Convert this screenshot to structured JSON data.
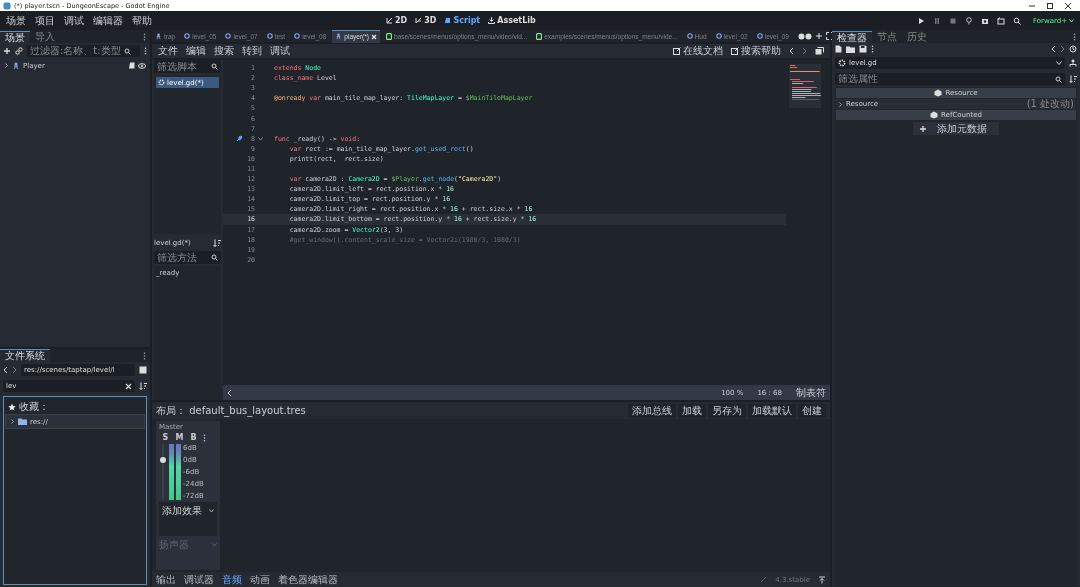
{
  "window": {
    "title": "(*) player.tscn - DungeonEscape - Godot Engine"
  },
  "menu": [
    "场景",
    "项目",
    "调试",
    "编辑器",
    "帮助"
  ],
  "workspaces": [
    {
      "label": "2D",
      "kind": "planar",
      "selected": false
    },
    {
      "label": "3D",
      "kind": "spatial",
      "selected": false
    },
    {
      "label": "Script",
      "kind": "script",
      "selected": true
    },
    {
      "label": "AssetLib",
      "kind": "assetlib",
      "selected": false
    }
  ],
  "renderer": "Forward+",
  "scene_dock": {
    "tabs": [
      {
        "label": "场景",
        "selected": true
      },
      {
        "label": "导入",
        "selected": false
      }
    ],
    "filter": {
      "placeholder": "过滤器:名称、t:类型"
    },
    "tree": [
      {
        "label": "Player",
        "expanded": false
      }
    ]
  },
  "filesystem": {
    "tab": "文件系统",
    "path": "res://scenes/taptap/level/l",
    "search": "lev",
    "favorites": "收藏：",
    "tree": [
      {
        "label": "res://",
        "expanded": false
      }
    ]
  },
  "editor_tabs": [
    {
      "label": "trap",
      "kind": "node",
      "selected": false
    },
    {
      "label": "level_05",
      "kind": "scene",
      "selected": false
    },
    {
      "label": "level_07",
      "kind": "scene",
      "selected": false
    },
    {
      "label": "test",
      "kind": "scene",
      "selected": false
    },
    {
      "label": "level_08",
      "kind": "scene",
      "selected": false
    },
    {
      "label": "player(*)",
      "kind": "node",
      "selected": true
    },
    {
      "label": "base/scenes/menus/options_menu/video/vid...",
      "kind": "script",
      "selected": false
    },
    {
      "label": "examples/scenes/menus/options_menu/vide...",
      "kind": "script",
      "selected": false
    },
    {
      "label": "Hud",
      "kind": "scene",
      "selected": false
    },
    {
      "label": "level_02",
      "kind": "scene",
      "selected": false
    },
    {
      "label": "level_09",
      "kind": "scene",
      "selected": false
    }
  ],
  "script_menu": [
    "文件",
    "编辑",
    "搜索",
    "转到",
    "调试"
  ],
  "help_links": [
    "在线文档",
    "搜索帮助"
  ],
  "script_list": {
    "filter": {
      "placeholder": "筛选脚本"
    },
    "items": [
      {
        "label": "level.gd(*)",
        "selected": true
      }
    ],
    "current": "level.gd(*)",
    "method_filter": {
      "placeholder": "筛选方法"
    },
    "methods": [
      "_ready"
    ]
  },
  "code": {
    "lines": [
      {
        "number": "1",
        "current": false,
        "signal": false,
        "foldable": false,
        "tokens": [
          {
            "t": "extends",
            "kind": "keyword"
          },
          {
            "t": " Node",
            "kind": "type"
          }
        ]
      },
      {
        "number": "2",
        "current": false,
        "signal": false,
        "foldable": false,
        "tokens": [
          {
            "t": "class_name",
            "kind": "keyword"
          },
          {
            "t": " Level",
            "kind": "plain"
          }
        ]
      },
      {
        "number": "3",
        "current": false,
        "signal": false,
        "foldable": false
      },
      {
        "number": "4",
        "current": false,
        "signal": false,
        "foldable": false,
        "tokens": [
          {
            "t": "@onready",
            "kind": "annotation"
          },
          {
            "t": " var",
            "kind": "keyword"
          },
          {
            "t": " main_tile_map_layer: ",
            "kind": "plain"
          },
          {
            "t": "TileMapLayer",
            "kind": "type"
          },
          {
            "t": " = ",
            "kind": "plain"
          },
          {
            "t": "$MainTileMapLayer",
            "kind": "node"
          }
        ]
      },
      {
        "number": "5",
        "current": false,
        "signal": false,
        "foldable": false
      },
      {
        "number": "6",
        "current": false,
        "signal": false,
        "foldable": false
      },
      {
        "number": "7",
        "current": false,
        "signal": false,
        "foldable": false
      },
      {
        "number": "8",
        "current": false,
        "signal": true,
        "foldable": true,
        "tokens": [
          {
            "t": "func",
            "kind": "keyword"
          },
          {
            "t": " _ready() -> ",
            "kind": "plain"
          },
          {
            "t": "void",
            "kind": "keyword"
          },
          {
            "t": ":",
            "kind": "plain"
          }
        ]
      },
      {
        "number": "9",
        "current": false,
        "signal": false,
        "foldable": false,
        "tokens": [
          {
            "t": "\tvar",
            "kind": "keyword"
          },
          {
            "t": " rect := main_tile_map_layer.",
            "kind": "plain"
          },
          {
            "t": "get_used_rect",
            "kind": "function"
          },
          {
            "t": "()",
            "kind": "plain"
          }
        ]
      },
      {
        "number": "10",
        "current": false,
        "signal": false,
        "foldable": false,
        "tokens": [
          {
            "t": "\tprintt(rect,  rect.size)",
            "kind": "plain"
          }
        ]
      },
      {
        "number": "11",
        "current": false,
        "signal": false,
        "foldable": false
      },
      {
        "number": "12",
        "current": false,
        "signal": false,
        "foldable": false,
        "tokens": [
          {
            "t": "\tvar",
            "kind": "keyword"
          },
          {
            "t": " camera2D : ",
            "kind": "plain"
          },
          {
            "t": "Camera2D",
            "kind": "type"
          },
          {
            "t": " = ",
            "kind": "plain"
          },
          {
            "t": "$Player",
            "kind": "node"
          },
          {
            "t": ".",
            "kind": "plain"
          },
          {
            "t": "get_node",
            "kind": "function"
          },
          {
            "t": "(",
            "kind": "plain"
          },
          {
            "t": "\"Camera2D\"",
            "kind": "string"
          },
          {
            "t": ")",
            "kind": "plain"
          }
        ]
      },
      {
        "number": "13",
        "current": false,
        "signal": false,
        "foldable": false,
        "tokens": [
          {
            "t": "\tcamera2D.limit_left = rect.position.x * ",
            "kind": "plain"
          },
          {
            "t": "16",
            "kind": "number"
          }
        ]
      },
      {
        "number": "14",
        "current": false,
        "signal": false,
        "foldable": false,
        "tokens": [
          {
            "t": "\tcamera2D.limit_top = rect.position.y * ",
            "kind": "plain"
          },
          {
            "t": "16",
            "kind": "number"
          }
        ]
      },
      {
        "number": "15",
        "current": false,
        "signal": false,
        "foldable": false,
        "tokens": [
          {
            "t": "\tcamera2D.limit_right = rect.position.x * ",
            "kind": "plain"
          },
          {
            "t": "16",
            "kind": "number"
          },
          {
            "t": " + rect.size.x * ",
            "kind": "plain"
          },
          {
            "t": "16",
            "kind": "number"
          }
        ]
      },
      {
        "number": "16",
        "current": true,
        "signal": false,
        "foldable": false,
        "tokens": [
          {
            "t": "\tcamera2D.limit_bottom = rect.position.y * ",
            "kind": "plain"
          },
          {
            "t": "16",
            "kind": "number"
          },
          {
            "t": " + rect.size.y * ",
            "kind": "plain"
          },
          {
            "t": "16",
            "kind": "number"
          }
        ]
      },
      {
        "number": "17",
        "current": false,
        "signal": false,
        "foldable": false,
        "tokens": [
          {
            "t": "\tcamera2D.zoom = ",
            "kind": "plain"
          },
          {
            "t": "Vector2",
            "kind": "type"
          },
          {
            "t": "(3, 3)",
            "kind": "plain"
          }
        ]
      },
      {
        "number": "18",
        "current": false,
        "signal": false,
        "foldable": false,
        "tokens": [
          {
            "t": "\t#get_window().content_scale_size = Vector2i(1980/3, 1080/3)",
            "kind": "comment"
          }
        ]
      },
      {
        "number": "19",
        "current": false,
        "signal": false,
        "foldable": false
      },
      {
        "number": "20",
        "current": false,
        "signal": false,
        "foldable": false
      }
    ]
  },
  "status_bar": {
    "zoom": "100 %",
    "position": "16 :  68",
    "indent": "制表符"
  },
  "audio": {
    "layout": "布局： default_bus_layout.tres",
    "buttons": [
      "添加总线",
      "加载",
      "另存为",
      "加载默认",
      "创建"
    ],
    "bus": {
      "name": "Master",
      "toggles": [
        {
          "label": "S",
          "on": false
        },
        {
          "label": "M",
          "on": false
        },
        {
          "label": "B",
          "on": false
        }
      ],
      "volume": {
        "level": 0.72
      },
      "scale": [
        "6dB",
        "0dB",
        "-6dB",
        "-24dB",
        "-72dB"
      ],
      "add_effect": "添加效果",
      "output": {
        "value": "扬声器",
        "disabled": true
      }
    }
  },
  "bottom_tabs": [
    {
      "label": "输出",
      "selected": false
    },
    {
      "label": "调试器",
      "selected": false
    },
    {
      "label": "音频",
      "selected": true
    },
    {
      "label": "动画",
      "selected": false
    },
    {
      "label": "着色器编辑器",
      "selected": false
    }
  ],
  "version": "4.3.stable",
  "inspector": {
    "tabs": [
      {
        "label": "检查器",
        "selected": true
      },
      {
        "label": "节点",
        "selected": false
      },
      {
        "label": "历史",
        "selected": false
      }
    ],
    "resource": "level.gd",
    "filter": {
      "placeholder": "筛选属性"
    },
    "sections": [
      {
        "kind": "header",
        "label": "Resource"
      },
      {
        "kind": "group",
        "label": "Resource",
        "note": "(1 处改动)",
        "expanded": false
      },
      {
        "kind": "header",
        "label": "RefCounted"
      }
    ],
    "add_metadata": "添加元数据"
  }
}
